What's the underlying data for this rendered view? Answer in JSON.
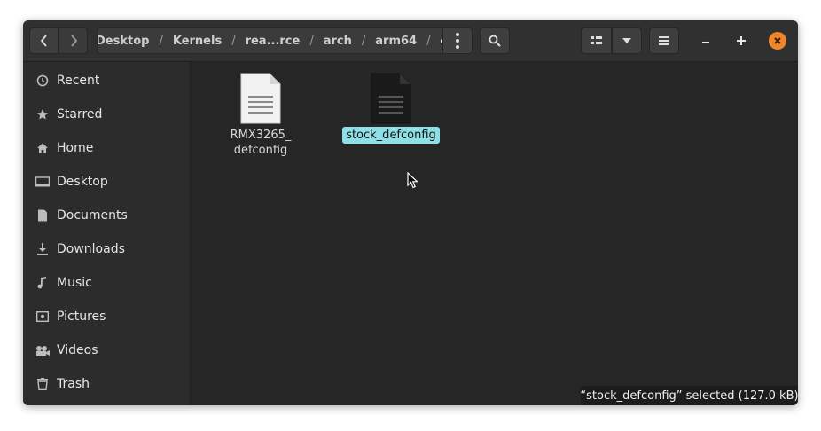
{
  "breadcrumb": {
    "items": [
      "Desktop",
      "Kernels",
      "rea...rce",
      "arch",
      "arm64",
      "configs"
    ],
    "separator": "/"
  },
  "window_controls": {
    "minimize": "–",
    "maximize": "+",
    "close": "×"
  },
  "sidebar": {
    "items": [
      {
        "label": "Recent",
        "icon": "clock-icon"
      },
      {
        "label": "Starred",
        "icon": "star-icon"
      },
      {
        "label": "Home",
        "icon": "home-icon"
      },
      {
        "label": "Desktop",
        "icon": "desktop-icon"
      },
      {
        "label": "Documents",
        "icon": "document-icon"
      },
      {
        "label": "Downloads",
        "icon": "download-icon"
      },
      {
        "label": "Music",
        "icon": "music-icon"
      },
      {
        "label": "Pictures",
        "icon": "picture-icon"
      },
      {
        "label": "Videos",
        "icon": "video-icon"
      },
      {
        "label": "Trash",
        "icon": "trash-icon"
      }
    ]
  },
  "files": [
    {
      "name_line1": "RMX3265_",
      "name_line2": "defconfig",
      "selected": false
    },
    {
      "name_line1": "stock_defconfig",
      "name_line2": "",
      "selected": true
    }
  ],
  "status": {
    "text": "“stock_defconfig” selected  (127.0 kB)"
  },
  "colors": {
    "accent": "#8ee0e6",
    "close": "#f0862a",
    "background": "#262626"
  }
}
